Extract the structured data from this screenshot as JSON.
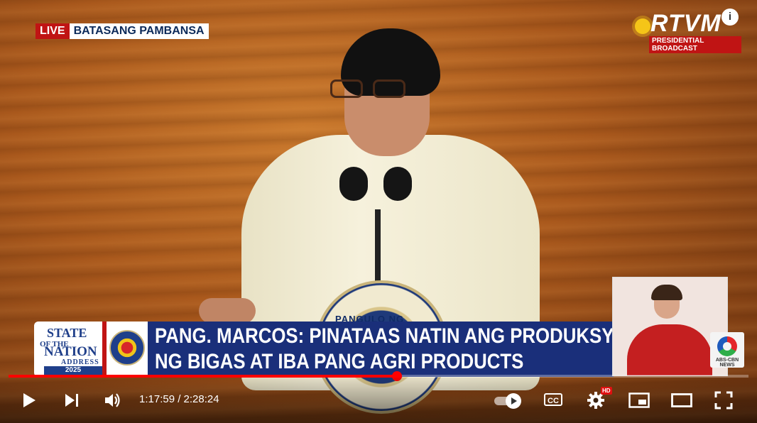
{
  "overlay": {
    "live_label": "LIVE",
    "location": "BATASANG PAMBANSA",
    "channel_logo": "RTVM",
    "channel_sub": "PRESIDENTIAL BROADCAST",
    "info_icon": "i"
  },
  "lower_third": {
    "logo_line1": "STATE",
    "logo_line2": "OF THE",
    "logo_line3": "NATION",
    "logo_line4": "ADDRESS",
    "logo_year": "2025",
    "headline_line1": "PANG. MARCOS: PINATAAS NATIN ANG PRODUKSYON",
    "headline_line2": "NG BIGAS AT IBA PANG AGRI PRODUCTS"
  },
  "seal_text": "PANGULO NG",
  "abs_label": "ABS-CBN NEWS",
  "player": {
    "current_time": "1:17:59",
    "duration": "2:28:24",
    "time_display": "1:17:59 / 2:28:24",
    "progress_fraction": 0.525,
    "cc_label": "CC",
    "hd_badge": "HD",
    "accent": "#ff0000"
  }
}
